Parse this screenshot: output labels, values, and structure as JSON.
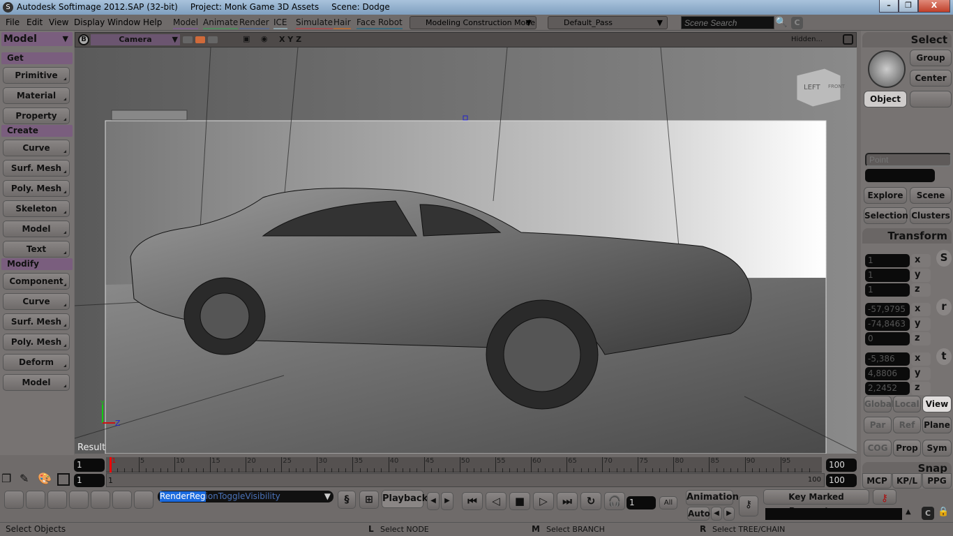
{
  "window": {
    "app": "Autodesk Softimage 2012.SAP (32-bit)",
    "project": "Project: Monk Game 3D Assets",
    "scene": "Scene: Dodge",
    "minimize": "–",
    "restore": "❐",
    "close": "X"
  },
  "menu": {
    "items": [
      "File",
      "Edit",
      "View",
      "Display",
      "Window",
      "Help"
    ],
    "modes": [
      {
        "label": "Model",
        "color": "#7a5e8a"
      },
      {
        "label": "Animate",
        "color": "#4f8a5e"
      },
      {
        "label": "Render",
        "color": "#5a6a8a"
      },
      {
        "label": "ICE",
        "color": "#8aa0a8"
      },
      {
        "label": "Simulate",
        "color": "#a05050"
      },
      {
        "label": "Hair",
        "color": "#b06a3a"
      },
      {
        "label": "Face Robot",
        "color": "#3a6a7a"
      }
    ],
    "construction_mode": "Modeling Construction Mode",
    "pass": "Default_Pass",
    "search_placeholder": "Scene Search",
    "clear": "C"
  },
  "left": {
    "module": "Model",
    "sections": [
      {
        "title": "Get",
        "items": [
          "Primitive",
          "Material",
          "Property"
        ]
      },
      {
        "title": "Create",
        "items": [
          "Curve",
          "Surf. Mesh",
          "Poly. Mesh",
          "Skeleton",
          "Model",
          "Text"
        ]
      },
      {
        "title": "Modify",
        "items": [
          "Component",
          "Curve",
          "Surf. Mesh",
          "Poly. Mesh",
          "Deform",
          "Model"
        ]
      }
    ]
  },
  "viewport": {
    "b": "B",
    "camera": "Camera",
    "axes": "X Y Z",
    "display_mode": "Hidden...",
    "cube_left": "LEFT",
    "cube_front": "FRONT",
    "result": "Result",
    "axis_y": "Y",
    "axis_z": "Z"
  },
  "right": {
    "select_title": "Select",
    "group": "Group",
    "center": "Center",
    "object": "Object",
    "point_placeholder": "Point",
    "explore": "Explore",
    "scene": "Scene",
    "selection": "Selection",
    "clusters": "Clusters",
    "transform_title": "Transform",
    "scale": {
      "label": "S",
      "x": "1",
      "y": "1",
      "z": "1"
    },
    "rotate": {
      "label": "r",
      "x": "-57,9795",
      "y": "-74,8463",
      "z": "0"
    },
    "translate": {
      "label": "t",
      "x": "-5,386",
      "y": "4,8806",
      "z": "2,2452"
    },
    "axis_labels": [
      "x",
      "y",
      "z"
    ],
    "global": "Global",
    "local": "Local",
    "view": "View",
    "par": "Par",
    "ref": "Ref",
    "plane": "Plane",
    "cog": "COG",
    "prop": "Prop",
    "sym": "Sym",
    "snap_title": "Snap",
    "tabs": [
      "MCP",
      "KP/L",
      "PPG"
    ]
  },
  "timeline": {
    "start": "1",
    "range_start": "1",
    "current": "1",
    "ticks": [
      "1",
      "5",
      "10",
      "15",
      "20",
      "25",
      "30",
      "35",
      "40",
      "45",
      "50",
      "55",
      "60",
      "65",
      "70",
      "75",
      "80",
      "85",
      "90",
      "95"
    ],
    "range_end_label": "100",
    "end": "100",
    "range_end": "100"
  },
  "bottom": {
    "command": "RenderRegionToggleVisibility",
    "command_selected": "RenderReg",
    "playback": "Playback",
    "frame": "1",
    "all": "All",
    "animation": "Animation",
    "auto": "Auto",
    "key_marked": "Key Marked Parameters",
    "c": "C"
  },
  "status": {
    "main": "Select Objects",
    "l_key": "L",
    "l_text": "Select NODE",
    "m_key": "M",
    "m_text": "Select BRANCH",
    "r_key": "R",
    "r_text": "Select TREE/CHAIN"
  }
}
